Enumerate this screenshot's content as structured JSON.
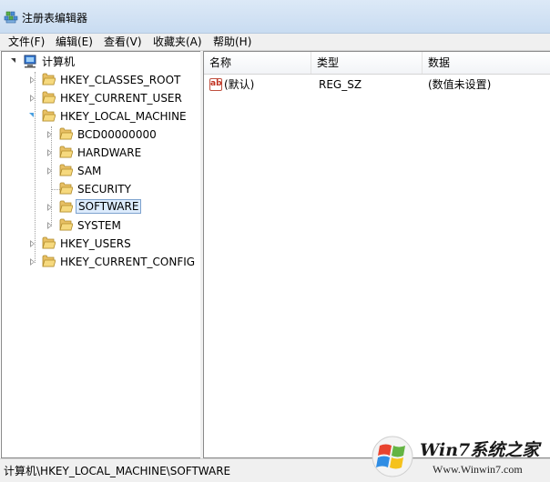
{
  "window": {
    "title": "注册表编辑器"
  },
  "menu": [
    "文件(F)",
    "编辑(E)",
    "查看(V)",
    "收藏夹(A)",
    "帮助(H)"
  ],
  "tree": {
    "root": "计算机",
    "hives": [
      "HKEY_CLASSES_ROOT",
      "HKEY_CURRENT_USER",
      "HKEY_LOCAL_MACHINE",
      "HKEY_USERS",
      "HKEY_CURRENT_CONFIG"
    ],
    "hklm_children": [
      "BCD00000000",
      "HARDWARE",
      "SAM",
      "SECURITY",
      "SOFTWARE",
      "SYSTEM"
    ],
    "selected": "SOFTWARE"
  },
  "list": {
    "columns": [
      "名称",
      "类型",
      "数据"
    ],
    "rows": [
      {
        "icon": "ab-string-value-icon",
        "name": "(默认)",
        "type": "REG_SZ",
        "data": "(数值未设置)"
      }
    ],
    "icon_text": "ab"
  },
  "status": {
    "path": "计算机\\HKEY_LOCAL_MACHINE\\SOFTWARE"
  },
  "watermark": {
    "brand": "Win7系统之家",
    "url": "Www.Winwin7.com"
  },
  "colors": {
    "selection": "#dcebfc",
    "selection_border": "#7da2ce",
    "folder": "#e8c064",
    "titlebar": "#c9dcf1"
  }
}
